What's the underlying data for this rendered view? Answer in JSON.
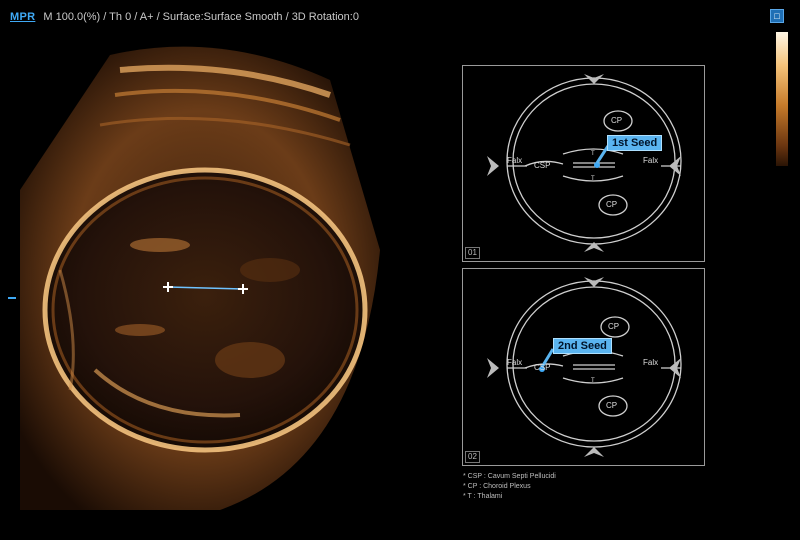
{
  "header": {
    "mode": "MPR",
    "params": "M 100.0(%) / Th 0 / A+ / Surface:Surface Smooth / 3D Rotation:0"
  },
  "colors": {
    "accent": "#3fa9f5",
    "seed_label": "#5ab4f0",
    "echo": "#c9893f"
  },
  "icons": {
    "corner": "screen-toggle-icon",
    "colorbar": "gray-map-bar-icon"
  },
  "ultrasound": {
    "caliper": "distance-caliper-icon"
  },
  "guide": {
    "panel1": {
      "number": "01",
      "seed": "1st Seed",
      "labels": {
        "falx_left": "Falx",
        "falx_right": "Falx",
        "csp": "CSP",
        "cp_top": "CP",
        "cp_bottom": "CP",
        "t_top": "T",
        "t_bottom": "T"
      }
    },
    "panel2": {
      "number": "02",
      "seed": "2nd Seed",
      "labels": {
        "falx_left": "Falx",
        "falx_right": "Falx",
        "csp": "CSP",
        "cp_top": "CP",
        "cp_bottom": "CP",
        "t": "T"
      }
    }
  },
  "legend": [
    "* CSP : Cavum Septi Pellucidi",
    "* CP : Choroid Plexus",
    "* T : Thalami"
  ]
}
